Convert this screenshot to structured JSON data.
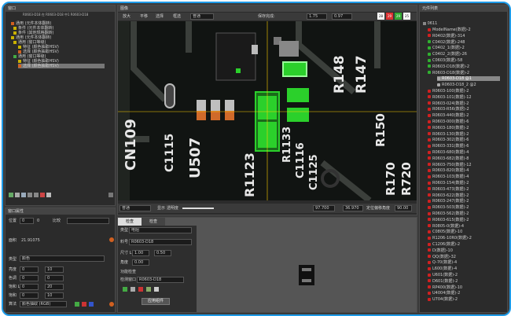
{
  "left_top_panel": {
    "title": "窗口",
    "header": "R0603-D18 在 R0603-D18 中1 R0603-D18",
    "tree": [
      "通用 (元件本体翻转)",
      "条件 (元件本体翻转)",
      "条件 (其他规格翻转)",
      "通用 (元件本体翻转)",
      "通用 (窗口等级)",
      "特征 (颜色抽取HSV)",
      "选择 (颜色抽取HSV)",
      "通用 (窗口等级)",
      "特征 (颜色抽取HSV)",
      "选择 (颜色抽取HSV)"
    ]
  },
  "left_bottom_panel": {
    "title": "窗口属性",
    "row1_label": "位置",
    "row1_value": "0",
    "row1_mid": "0",
    "row1_right": "比较",
    "row2_label": "面积",
    "row2_value": "21.91075",
    "type_label": "类型",
    "type_value": "颜色",
    "range1_label": "亮度",
    "range1_min": "0",
    "range1_max": "10",
    "range2_label": "色调",
    "range2_min": "0",
    "range2_max": "0",
    "range3_label": "饱和 L",
    "range3_min": "0",
    "range3_max": "20",
    "range4_label": "饱和",
    "range4_min": "0",
    "range4_max": "10",
    "method_label": "算法",
    "method_value": "颜色抽取 (RGB)",
    "bottom_checks": [
      "窗口",
      "区域",
      "检查区域"
    ]
  },
  "image_view": {
    "title": "图像",
    "toolbar_items": [
      "放大",
      "平移",
      "选择",
      "框选"
    ],
    "mode_value": "普通",
    "save_label": "保存完成:",
    "field1": "1.75",
    "field2": "0.97",
    "badges": [
      "28",
      "29",
      "29",
      "25"
    ],
    "pcb_labels": [
      "CN109",
      "C1115",
      "U507",
      "R1123",
      "R1133",
      "C1116",
      "C1125",
      "R148",
      "R147",
      "R150",
      "R170",
      "R720"
    ],
    "status_left": "普通",
    "status_check": "显示",
    "status_transparency": "透明度",
    "status_x": "97.700",
    "status_y": "36.970",
    "status_angle_label": "定位偏移角度",
    "status_angle": "90.00"
  },
  "detail_panel": {
    "tabs": [
      "检查",
      "检查"
    ],
    "type_label": "类型",
    "type_value": "电阻",
    "part_label": "料号",
    "part_value": "R0603-D18",
    "size_label": "尺寸 L",
    "size_l": "1.00",
    "size_w": "0.50",
    "angle_label": "角度",
    "angle_value": "0.00",
    "thresh_label": "功能检查",
    "thresh2_label": "检测窗口",
    "thresh2_value": "R0603-D18",
    "apply_button": "应用组件"
  },
  "right_panel": {
    "title": "元件列表",
    "root": "0611",
    "items": [
      {
        "label": "ModelName(数据)-2",
        "color": "#d02020"
      },
      {
        "label": "R0402(数据)-314",
        "color": "#d02020"
      },
      {
        "label": "C0402(数据)-248",
        "color": "#30b030"
      },
      {
        "label": "C0402_1(数据)-2",
        "color": "#30b030"
      },
      {
        "label": "C0402_2(数据)-26",
        "color": "#30b030"
      },
      {
        "label": "C0603(数据)-58",
        "color": "#30b030"
      },
      {
        "label": "R0603-D18(数据)-2",
        "color": "#30b030"
      },
      {
        "label": "R0603-D18(数据)-2",
        "color": "#30b030"
      },
      {
        "label": "R0603-D18 @1",
        "color": "#aaaaaa"
      },
      {
        "label": "R0603-D18_2 @2",
        "color": "#aaaaaa"
      },
      {
        "label": "R0603-100(数据)-2",
        "color": "#d02020"
      },
      {
        "label": "R0603-101(数据)-12",
        "color": "#d02020"
      },
      {
        "label": "R0603-024(数据)-2",
        "color": "#d02020"
      },
      {
        "label": "R0603-R56(数据)-2",
        "color": "#d02020"
      },
      {
        "label": "R0603-440(数据)-2",
        "color": "#d02020"
      },
      {
        "label": "R0603-000(数据)-6",
        "color": "#d02020"
      },
      {
        "label": "R0603-180(数据)-2",
        "color": "#d02020"
      },
      {
        "label": "R0603-130(数据)-2",
        "color": "#d02020"
      },
      {
        "label": "R0603-302(数据)-6",
        "color": "#d02020"
      },
      {
        "label": "R0603-331(数据)-6",
        "color": "#d02020"
      },
      {
        "label": "R0603-680(数据)-4",
        "color": "#d02020"
      },
      {
        "label": "R0603-682(数据)-8",
        "color": "#d02020"
      },
      {
        "label": "R0603-750(数据)-12",
        "color": "#d02020"
      },
      {
        "label": "R0603-820(数据)-4",
        "color": "#d02020"
      },
      {
        "label": "R0603-103(数据)-4",
        "color": "#d02020"
      },
      {
        "label": "R0603-154(数据)-2",
        "color": "#d02020"
      },
      {
        "label": "R0603-473(数据)-2",
        "color": "#d02020"
      },
      {
        "label": "R0603-622(数据)-2",
        "color": "#d02020"
      },
      {
        "label": "R0603-247(数据)-2",
        "color": "#d02020"
      },
      {
        "label": "R0603-503(数据)-2",
        "color": "#d02020"
      },
      {
        "label": "R0603-562(数据)-2",
        "color": "#d02020"
      },
      {
        "label": "R0603-615(数据)-2",
        "color": "#d02020"
      },
      {
        "label": "R0805-0(数据)-4",
        "color": "#d02020"
      },
      {
        "label": "C0805(数据)-10",
        "color": "#d02020"
      },
      {
        "label": "R1206-10R0(数据)-2",
        "color": "#d02020"
      },
      {
        "label": "C1206(数据)-2",
        "color": "#d02020"
      },
      {
        "label": "D(数据)-10",
        "color": "#d02020"
      },
      {
        "label": "QQ(数据)-32",
        "color": "#d02020"
      },
      {
        "label": "Q-70(数据)-4",
        "color": "#d02020"
      },
      {
        "label": "L600(数据)-4",
        "color": "#d02020"
      },
      {
        "label": "U601(数据)-2",
        "color": "#d02020"
      },
      {
        "label": "D601(数据)-2",
        "color": "#d02020"
      },
      {
        "label": "RP400(数据)-10",
        "color": "#d02020"
      },
      {
        "label": "U4004(数据)-2",
        "color": "#d02020"
      },
      {
        "label": "U704(数据)-2",
        "color": "#d02020"
      }
    ]
  }
}
